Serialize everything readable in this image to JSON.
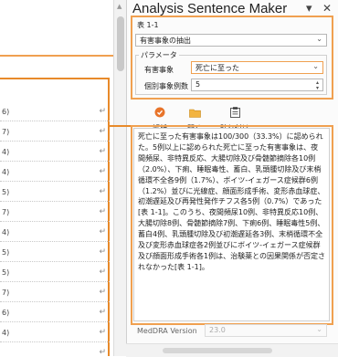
{
  "document": {
    "rows": [
      {
        "marker": "6)"
      },
      {
        "marker": "7)"
      },
      {
        "marker": "4)"
      },
      {
        "marker": "4)"
      },
      {
        "marker": "5)"
      },
      {
        "marker": "7)"
      },
      {
        "marker": "4)"
      },
      {
        "marker": "5)"
      },
      {
        "marker": "5)"
      },
      {
        "marker": "7)"
      },
      {
        "marker": "6)"
      },
      {
        "marker": "4)"
      },
      {
        "marker": ""
      }
    ]
  },
  "pane": {
    "title": "Analysis Sentence Maker",
    "controls": {
      "dropdown": "▾",
      "close": "✕"
    },
    "table_label": "表 1-1",
    "action_select": "有害事象の抽出",
    "params_title": "パラメータ",
    "param1_label": "有害事象",
    "param1_value": "死亡に至った",
    "param2_label": "個別事象例数",
    "param2_value": "5",
    "buttons": {
      "analyze": "解析",
      "open": "開く",
      "paste": "貼り付け"
    },
    "text": "死亡に至った有害事象は100/300（33.3%）に認められた。5例以上に認められた死亡に至った有害事象は、夜間頻尿、非特異反応、大腸切除及び骨髄節摘除各10例（2.0%）、下痢、睡眠毒性、蓄白、乳頭腫切除及び末梢循環不全各9例（1.7%）、ボイツ-イェガース症候群6例（1.2%）並びに光線症、顔面形成手術、変形赤血球症、初潮遅延及び再発性発作チフス各5例（0.7%）であった[表 1-1]。このうち、夜間頻尿10例、非特異反応10例、大腸切除8例、骨髄節摘除7例、下痢6例、睡眠毒性5例、蓄白4例、乳頭腫切除及び初潮遅延各3例、末梢循環不全及び変形赤血球症各2例並びにボイツ-イェガース症候群及び顔面形成手術各1例は、治験薬との因果関係が否定されなかった[表 1-1]。",
    "meddra_label": "MedDRA Version",
    "meddra_value": "23.0"
  }
}
